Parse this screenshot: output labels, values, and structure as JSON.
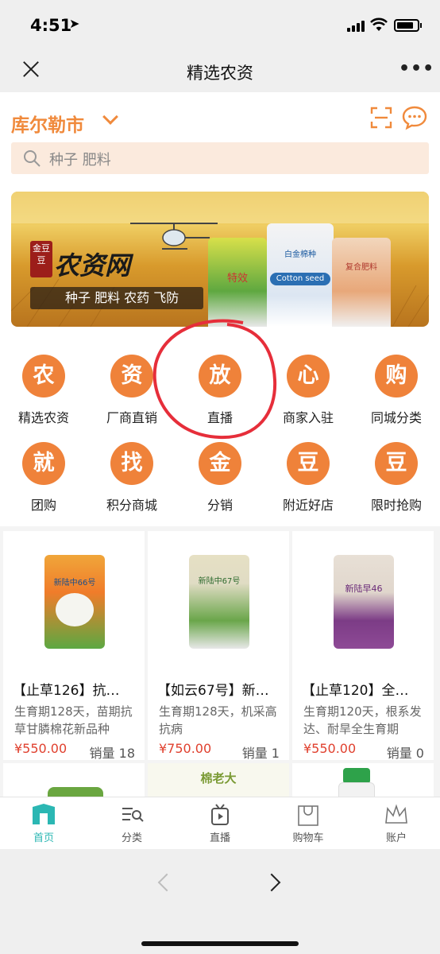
{
  "status": {
    "time": "4:51"
  },
  "nav": {
    "title": "精选农资"
  },
  "header": {
    "city": "库尔勒市",
    "search_placeholder": "种子 肥料"
  },
  "banner": {
    "logo": "农资网",
    "badge": "金豆豆",
    "tagline": "种子 肥料 农药 飞防",
    "bag1_text": "特效",
    "bag2_text": "白金棉种",
    "bag2_sub": "Cotton seed",
    "bag3_text": "复合肥料"
  },
  "categories": [
    {
      "icon_char": "农",
      "label": "精选农资"
    },
    {
      "icon_char": "资",
      "label": "厂商直销"
    },
    {
      "icon_char": "放",
      "label": "直播"
    },
    {
      "icon_char": "心",
      "label": "商家入驻"
    },
    {
      "icon_char": "购",
      "label": "同城分类"
    },
    {
      "icon_char": "就",
      "label": "团购"
    },
    {
      "icon_char": "找",
      "label": "积分商城"
    },
    {
      "icon_char": "金",
      "label": "分销"
    },
    {
      "icon_char": "豆",
      "label": "附近好店"
    },
    {
      "icon_char": "豆",
      "label": "限时抢购"
    }
  ],
  "products": [
    {
      "title": "【止草126】抗…",
      "desc": "生育期128天，苗期抗草甘膦棉花新品种",
      "price": "¥550.00",
      "sales": "销量 18",
      "pkg": "新陆中66号"
    },
    {
      "title": "【如云67号】新…",
      "desc": "生育期128天，机采高抗病",
      "price": "¥750.00",
      "sales": "销量 1",
      "pkg": "新陆中67号"
    },
    {
      "title": "【止草120】全…",
      "desc": "生育期120天，根系发达、耐旱全生育期",
      "price": "¥550.00",
      "sales": "销量 0",
      "pkg": "新陆早46"
    }
  ],
  "row2_label": "棉老大",
  "tabs": [
    {
      "label": "首页",
      "active": true
    },
    {
      "label": "分类"
    },
    {
      "label": "直播"
    },
    {
      "label": "购物车"
    },
    {
      "label": "账户"
    }
  ],
  "colors": {
    "accent": "#ef823a",
    "price": "#e0402e",
    "tab_active": "#2bb7b3"
  }
}
